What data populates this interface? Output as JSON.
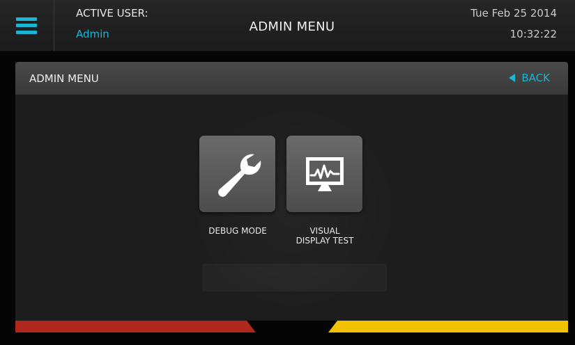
{
  "header": {
    "active_user_label": "ACTIVE USER:",
    "active_user_name": "Admin",
    "title": "ADMIN MENU",
    "date": "Tue Feb 25 2014",
    "time": "10:32:22",
    "menu_icon": "hamburger-menu-icon"
  },
  "panel": {
    "title": "ADMIN MENU",
    "back_label": "BACK",
    "back_icon": "back-arrow-icon"
  },
  "tiles": [
    {
      "label": "DEBUG MODE",
      "icon": "wrench-icon"
    },
    {
      "label": "VISUAL\nDISPLAY TEST",
      "icon": "monitor-waveform-icon"
    }
  ],
  "colors": {
    "accent": "#1bb6d6",
    "stripe_left": "#b0271e",
    "stripe_right": "#f2c200",
    "panel_bg": "#1d1d1d",
    "tile_bg": "#5c5c5c"
  }
}
